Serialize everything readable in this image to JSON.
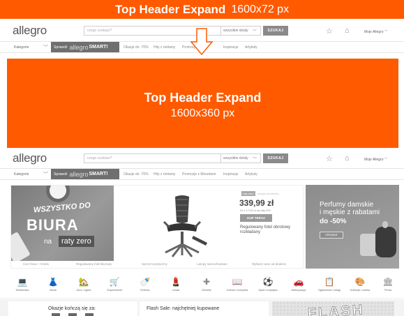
{
  "top_banner": {
    "title": "Top Header Expand",
    "size": "1600x72 px"
  },
  "header": {
    "logo": "allegro",
    "search_placeholder": "czego szukasz?",
    "category_select": "wszystkie działy",
    "search_button": "SZUKAJ",
    "account": "Moje Allegro"
  },
  "nav": {
    "categories": "Kategorie",
    "smart_prefix": "Sprawdź",
    "smart_logo": "allegro",
    "smart_label": "SMART!",
    "top_items": [
      "Okazje do -70%",
      "Hity z reklamy",
      "Promocje",
      "Inspiracje",
      "Artykuły"
    ],
    "bottom_items": [
      "Okazje do -70%",
      "Hity z reklamy",
      "Promocje z Monetami",
      "Inspiracje",
      "Artykuły"
    ]
  },
  "expand": {
    "title": "Top Header Expand",
    "size": "1600x360 px"
  },
  "hero": {
    "office_line1": "WSZYSTKO DO",
    "office_line2": "BIURA",
    "office_na": "na",
    "office_raty": "raty zero",
    "deal_tag": "raty zero",
    "deal_extra": "okazja weekendu",
    "price": "339,99 zł",
    "installment": "20 x 17,00 zł na raty 0%*",
    "buy_button": "KUP TERAZ",
    "product_desc": "Regulowany fotel obrotowy rozkładany",
    "labels": [
      "Cat Chow + Gratis",
      "Regulowany fotel biurowy",
      "Sprzęt turystyczny",
      "Lampy samochodowe",
      "Wybierz auto od dealera"
    ]
  },
  "perfume": {
    "line1": "Perfumy damskie",
    "line2": "i męskie z rabatami",
    "discount": "do -50%",
    "button": "SPRAWDŹ"
  },
  "categories": [
    {
      "label": "Elektronika",
      "icon": "💻"
    },
    {
      "label": "Moda",
      "icon": "👗"
    },
    {
      "label": "Dom i ogród",
      "icon": "🏡"
    },
    {
      "label": "Supermarket",
      "icon": "🛒"
    },
    {
      "label": "Dziecko",
      "icon": "🍼"
    },
    {
      "label": "Uroda",
      "icon": "💄"
    },
    {
      "label": "Zdrowie",
      "icon": "✚"
    },
    {
      "label": "Kultura i rozrywka",
      "icon": "📖"
    },
    {
      "label": "Sport i turystyka",
      "icon": "⚽"
    },
    {
      "label": "Motoryzacja",
      "icon": "🚗"
    },
    {
      "label": "Ogłoszenia i usługi",
      "icon": "📋"
    },
    {
      "label": "Kolekcje i sztuka",
      "icon": "🎨"
    },
    {
      "label": "Firma",
      "icon": "🏛"
    }
  ],
  "bottom": {
    "offers_title": "Okazje kończą się za:",
    "flash_sale_title": "Flash Sale: najchętniej kupowane",
    "flash_word": "FLASH"
  },
  "colors": {
    "accent": "#ff5a00",
    "button_gray": "#8a8a8a"
  }
}
